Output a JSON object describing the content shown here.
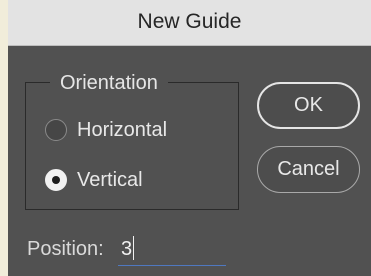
{
  "dialog": {
    "title": "New Guide",
    "orientation": {
      "legend": "Orientation",
      "options": [
        {
          "label": "Horizontal",
          "selected": false
        },
        {
          "label": "Vertical",
          "selected": true
        }
      ]
    },
    "buttons": {
      "ok_label": "OK",
      "cancel_label": "Cancel"
    },
    "position": {
      "label": "Position:",
      "value": "3"
    }
  },
  "colors": {
    "background": "#f1edda",
    "dialog_body": "#515151",
    "titlebar": "#e3e3e3",
    "field_underline": "#4f78c0"
  }
}
